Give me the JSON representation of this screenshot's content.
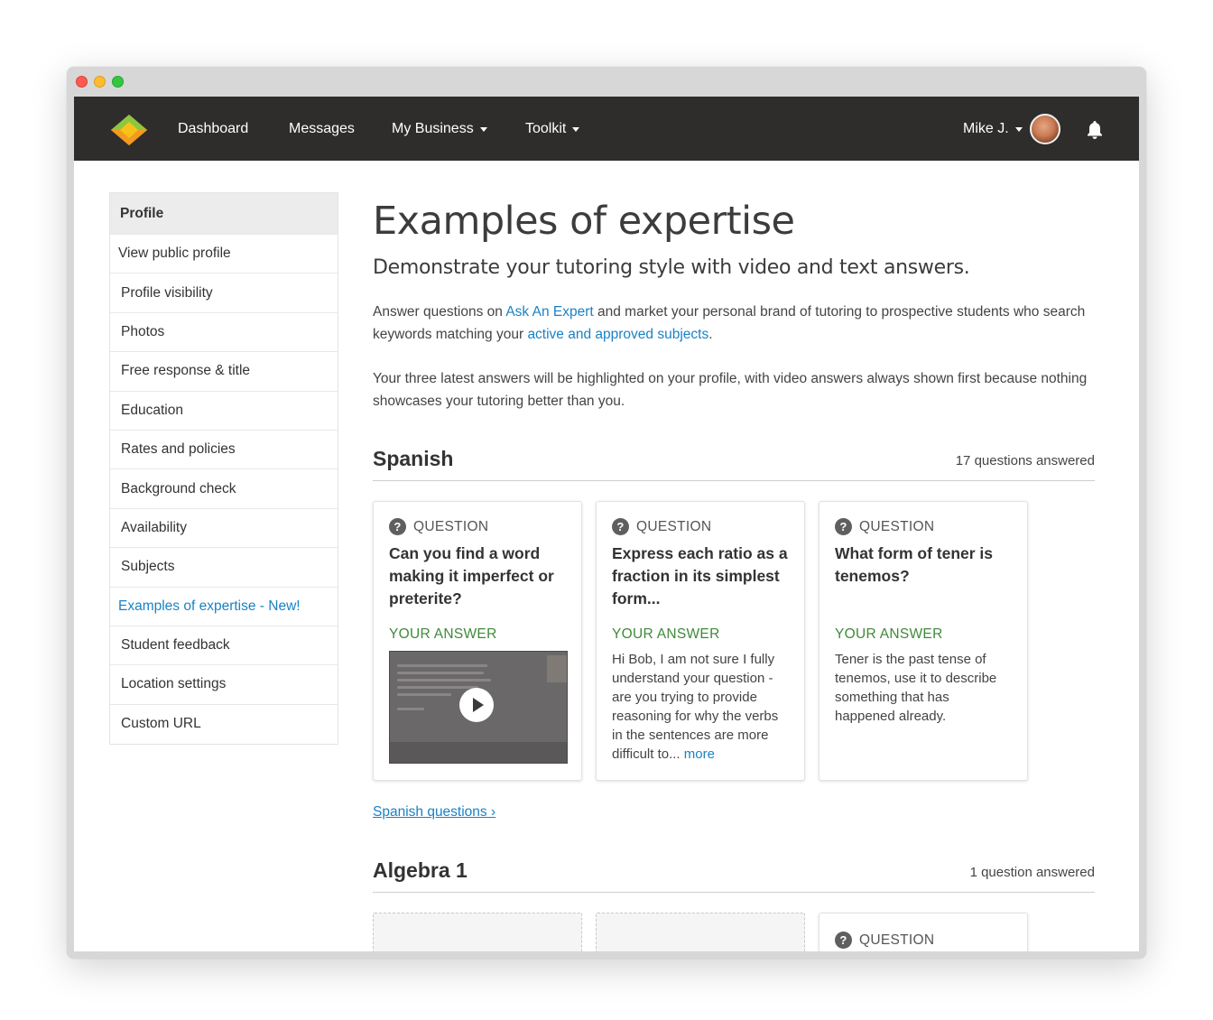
{
  "nav": {
    "items": [
      {
        "label": "Dashboard"
      },
      {
        "label": "Messages"
      },
      {
        "label": "My Business"
      },
      {
        "label": "Toolkit"
      }
    ],
    "user_label": "Mike J."
  },
  "sidebar": {
    "items": [
      {
        "label": "Profile"
      },
      {
        "label": "View public profile"
      },
      {
        "label": "Profile visibility"
      },
      {
        "label": "Photos"
      },
      {
        "label": "Free response & title"
      },
      {
        "label": "Education"
      },
      {
        "label": "Rates and policies"
      },
      {
        "label": "Background check"
      },
      {
        "label": "Availability"
      },
      {
        "label": "Subjects"
      },
      {
        "label": "Examples of expertise - New!"
      },
      {
        "label": "Student feedback"
      },
      {
        "label": "Location settings"
      },
      {
        "label": "Custom URL"
      }
    ]
  },
  "main": {
    "title": "Examples of expertise",
    "subtitle": "Demonstrate your tutoring style with video and text answers.",
    "para1": {
      "pre": "Answer questions on ",
      "link1": "Ask An Expert",
      "mid": " and market your personal brand of tutoring to prospective students who search keywords matching your ",
      "link2": "active and approved subjects",
      "post": "."
    },
    "para2": "Your three latest answers will be highlighted on your profile, with video answers always shown first because nothing showcases your tutoring better than you.",
    "sections": [
      {
        "title": "Spanish",
        "count": "17 questions answered",
        "cards": [
          {
            "q_label": "QUESTION",
            "question": "Can you find a word making it imperfect or preterite?",
            "a_label": "YOUR ANSWER"
          },
          {
            "q_label": "QUESTION",
            "question": "Express each ratio as a fraction in its simplest form...",
            "a_label": "YOUR ANSWER",
            "answer": "Hi Bob, I am not sure I fully understand your question - are you trying to provide reasoning for why the verbs in the sentences are more difficult to...",
            "more": "more"
          },
          {
            "q_label": "QUESTION",
            "question": "What form of tener is tenemos?",
            "a_label": "YOUR ANSWER",
            "answer": "Tener is the past tense of tenemos, use it to describe something that has happened already."
          }
        ],
        "link": "Spanish questions ›"
      },
      {
        "title": "Algebra 1",
        "count": "1 question answered",
        "cards": [
          {
            "q_label": "QUESTION"
          }
        ]
      }
    ]
  },
  "colors": {
    "nav_bg": "#2f2d2c",
    "link": "#1a82c4",
    "answer_label": "#3f8a3a"
  }
}
